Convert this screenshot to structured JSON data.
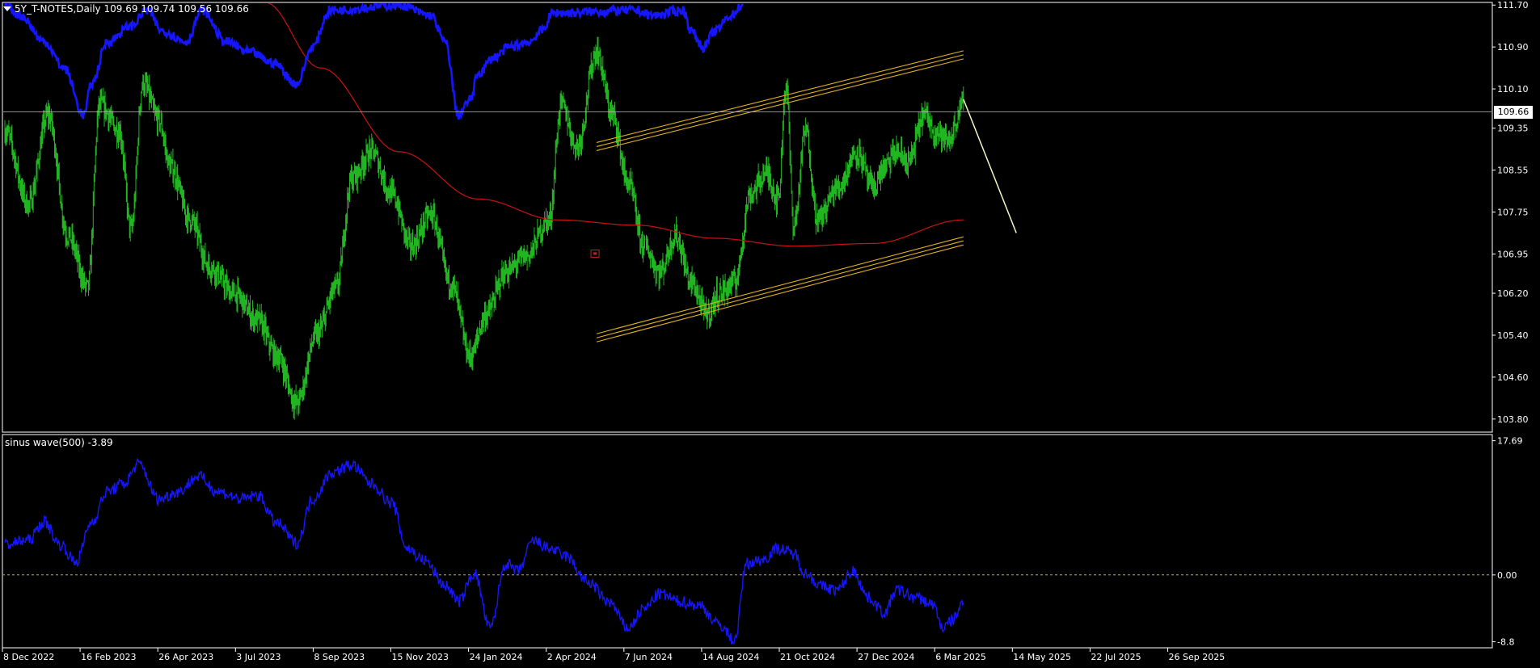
{
  "main_header": {
    "symbol": "5Y_T-NOTES,Daily",
    "ohlc": "109.69 109.74 109.56 109.66"
  },
  "sub_header": {
    "indicator": "sinus wave(500) -3.89"
  },
  "current_price": "109.66",
  "colors": {
    "background": "#000000",
    "candles": "#22b522",
    "moving_average": "#cc1111",
    "overlay_line": "#1515ff",
    "channel": "#e0b020",
    "forecast_line": "#f5f5c0",
    "zero_line": "#d4b800",
    "axis": "#ffffff"
  },
  "icons": [
    "menu-arrow-icon",
    "object-marker-icon"
  ],
  "chart_data": [
    {
      "type": "line",
      "title": "5Y_T-NOTES,Daily",
      "x_ticks": [
        "8 Dec 2022",
        "16 Feb 2023",
        "26 Apr 2023",
        "3 Jul 2023",
        "8 Sep 2023",
        "15 Nov 2023",
        "24 Jan 2024",
        "2 Apr 2024",
        "7 Jun 2024",
        "14 Aug 2024",
        "21 Oct 2024",
        "27 Dec 2024",
        "6 Mar 2025",
        "14 May 2025",
        "22 Jul 2025",
        "26 Sep 2025"
      ],
      "y_ticks": [
        "111.70",
        "110.90",
        "110.10",
        "109.35",
        "108.55",
        "107.75",
        "106.95",
        "106.20",
        "105.40",
        "104.60",
        "103.80"
      ],
      "ylim": [
        103.55,
        111.75
      ],
      "price_keypoints": [
        [
          0,
          109.3
        ],
        [
          30,
          107.9
        ],
        [
          55,
          109.6
        ],
        [
          80,
          107.3
        ],
        [
          105,
          106.3
        ],
        [
          120,
          109.8
        ],
        [
          145,
          109.3
        ],
        [
          160,
          107.4
        ],
        [
          175,
          110.2
        ],
        [
          195,
          109.5
        ],
        [
          210,
          108.6
        ],
        [
          235,
          107.6
        ],
        [
          260,
          106.7
        ],
        [
          290,
          106.2
        ],
        [
          320,
          105.7
        ],
        [
          345,
          105.0
        ],
        [
          370,
          104.1
        ],
        [
          395,
          105.4
        ],
        [
          420,
          106.3
        ],
        [
          440,
          108.4
        ],
        [
          465,
          108.9
        ],
        [
          490,
          108.1
        ],
        [
          515,
          107.1
        ],
        [
          540,
          107.7
        ],
        [
          565,
          106.4
        ],
        [
          590,
          105.0
        ],
        [
          610,
          105.8
        ],
        [
          635,
          106.6
        ],
        [
          660,
          106.9
        ],
        [
          690,
          107.6
        ],
        [
          705,
          109.8
        ],
        [
          725,
          109.0
        ],
        [
          750,
          110.8
        ],
        [
          770,
          109.6
        ],
        [
          790,
          108.3
        ],
        [
          810,
          107.1
        ],
        [
          830,
          106.6
        ],
        [
          850,
          107.3
        ],
        [
          870,
          106.4
        ],
        [
          890,
          105.8
        ],
        [
          905,
          106.2
        ],
        [
          925,
          106.4
        ],
        [
          945,
          108.1
        ],
        [
          965,
          108.5
        ],
        [
          980,
          108.0
        ],
        [
          990,
          110.2
        ],
        [
          1000,
          107.5
        ],
        [
          1015,
          109.3
        ],
        [
          1030,
          107.6
        ],
        [
          1055,
          108.2
        ],
        [
          1080,
          108.9
        ],
        [
          1100,
          108.2
        ],
        [
          1115,
          108.6
        ],
        [
          1130,
          108.9
        ],
        [
          1145,
          108.7
        ],
        [
          1165,
          109.6
        ],
        [
          1180,
          109.3
        ],
        [
          1195,
          109.1
        ],
        [
          1215,
          109.8
        ]
      ],
      "moving_average": [
        [
          330,
          111.75
        ],
        [
          400,
          110.5
        ],
        [
          500,
          108.9
        ],
        [
          600,
          108.0
        ],
        [
          700,
          107.6
        ],
        [
          800,
          107.5
        ],
        [
          900,
          107.25
        ],
        [
          1000,
          107.1
        ],
        [
          1100,
          107.15
        ],
        [
          1215,
          107.6
        ]
      ],
      "overlay_line_keypoints": [
        [
          0,
          111.7
        ],
        [
          20,
          111.5
        ],
        [
          50,
          111.0
        ],
        [
          75,
          110.5
        ],
        [
          100,
          109.6
        ],
        [
          110,
          110.2
        ],
        [
          130,
          111.0
        ],
        [
          160,
          111.3
        ],
        [
          180,
          111.6
        ],
        [
          200,
          111.2
        ],
        [
          230,
          111.0
        ],
        [
          250,
          111.6
        ],
        [
          280,
          111.0
        ],
        [
          310,
          110.8
        ],
        [
          340,
          110.6
        ],
        [
          370,
          110.2
        ],
        [
          390,
          110.9
        ],
        [
          412,
          111.6
        ],
        [
          500,
          111.7
        ],
        [
          540,
          111.5
        ],
        [
          558,
          111.0
        ],
        [
          575,
          109.6
        ],
        [
          590,
          109.9
        ],
        [
          600,
          110.4
        ],
        [
          620,
          110.7
        ],
        [
          640,
          110.9
        ],
        [
          665,
          111.0
        ],
        [
          680,
          111.2
        ],
        [
          695,
          111.55
        ],
        [
          800,
          111.6
        ],
        [
          820,
          111.5
        ],
        [
          860,
          111.6
        ],
        [
          870,
          111.2
        ],
        [
          885,
          110.9
        ],
        [
          900,
          111.2
        ],
        [
          920,
          111.5
        ],
        [
          935,
          111.7
        ]
      ],
      "channel_upper": {
        "from": [
          750,
          109.0
        ],
        "to": [
          1215,
          110.75
        ]
      },
      "channel_lower": {
        "from": [
          750,
          105.35
        ],
        "to": [
          1215,
          107.2
        ]
      },
      "forecast_line": {
        "from": [
          1215,
          109.9
        ],
        "to": [
          1282,
          107.35
        ]
      },
      "current_price": 109.66
    },
    {
      "type": "line",
      "title": "sinus wave(500)",
      "value": -3.89,
      "y_ticks": [
        "17.69",
        "0.00",
        "-8.8"
      ],
      "ylim": [
        -9.6,
        18.5
      ],
      "zero_line": 0,
      "series_keypoints": [
        [
          0,
          4.0
        ],
        [
          30,
          4.6
        ],
        [
          50,
          7.0
        ],
        [
          70,
          4.0
        ],
        [
          90,
          1.7
        ],
        [
          110,
          7.0
        ],
        [
          130,
          11.0
        ],
        [
          150,
          12.0
        ],
        [
          170,
          14.6
        ],
        [
          195,
          10.0
        ],
        [
          220,
          11.0
        ],
        [
          245,
          13.0
        ],
        [
          270,
          11.0
        ],
        [
          300,
          10.0
        ],
        [
          320,
          10.5
        ],
        [
          345,
          6.8
        ],
        [
          370,
          4.2
        ],
        [
          390,
          10.0
        ],
        [
          415,
          13.5
        ],
        [
          440,
          14.5
        ],
        [
          465,
          12.0
        ],
        [
          490,
          9.5
        ],
        [
          510,
          3.5
        ],
        [
          530,
          2.0
        ],
        [
          560,
          -1.5
        ],
        [
          575,
          -3.5
        ],
        [
          595,
          0.2
        ],
        [
          615,
          -7.0
        ],
        [
          635,
          1.5
        ],
        [
          650,
          0.5
        ],
        [
          670,
          4.5
        ],
        [
          690,
          3.5
        ],
        [
          710,
          2.5
        ],
        [
          740,
          -1.0
        ],
        [
          765,
          -3.5
        ],
        [
          790,
          -7.0
        ],
        [
          810,
          -4.5
        ],
        [
          830,
          -2.5
        ],
        [
          855,
          -3.5
        ],
        [
          880,
          -4.0
        ],
        [
          905,
          -6.5
        ],
        [
          925,
          -8.6
        ],
        [
          940,
          1.5
        ],
        [
          960,
          2.0
        ],
        [
          980,
          3.5
        ],
        [
          1000,
          2.8
        ],
        [
          1015,
          0.2
        ],
        [
          1035,
          -1.5
        ],
        [
          1055,
          -2.0
        ],
        [
          1075,
          0.5
        ],
        [
          1095,
          -3.0
        ],
        [
          1115,
          -5.0
        ],
        [
          1130,
          -2.0
        ],
        [
          1155,
          -3.0
        ],
        [
          1175,
          -3.8
        ],
        [
          1190,
          -7.0
        ],
        [
          1200,
          -6.0
        ],
        [
          1215,
          -3.8
        ]
      ]
    }
  ]
}
